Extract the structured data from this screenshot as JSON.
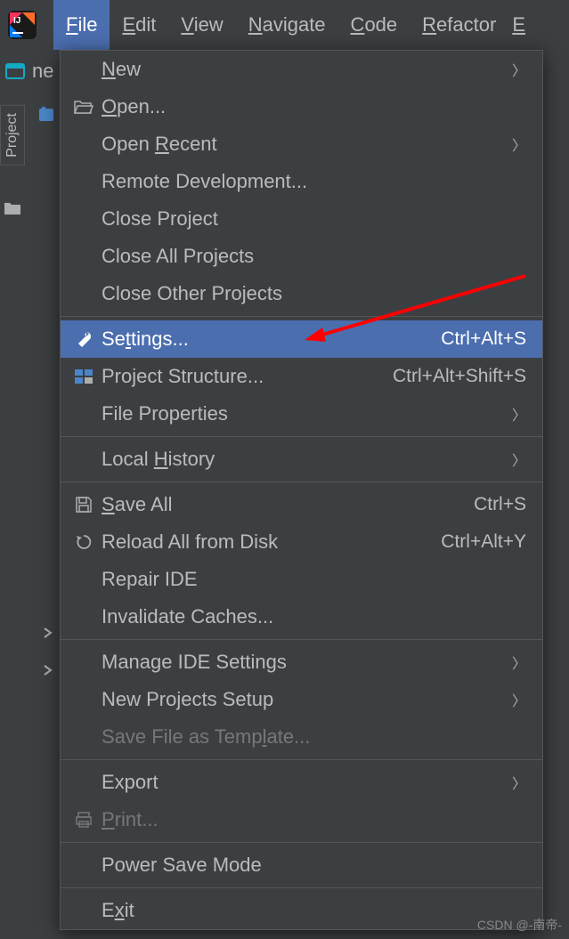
{
  "menubar": {
    "items": [
      {
        "label": "File",
        "mnemonic": "F"
      },
      {
        "label": "Edit",
        "mnemonic": "E"
      },
      {
        "label": "View",
        "mnemonic": "V"
      },
      {
        "label": "Navigate",
        "mnemonic": "N"
      },
      {
        "label": "Code",
        "mnemonic": "C"
      },
      {
        "label": "Refactor",
        "mnemonic": "R"
      }
    ],
    "trailing": "E"
  },
  "side": {
    "project_tab": "Project",
    "visible_text": "ne"
  },
  "menu": {
    "new": "New",
    "open": "Open...",
    "open_recent": "Open Recent",
    "remote_dev": "Remote Development...",
    "close_project": "Close Project",
    "close_all": "Close All Projects",
    "close_other": "Close Other Projects",
    "settings": "Settings...",
    "settings_shortcut": "Ctrl+Alt+S",
    "project_structure": "Project Structure...",
    "project_structure_shortcut": "Ctrl+Alt+Shift+S",
    "file_properties": "File Properties",
    "local_history": "Local History",
    "save_all": "Save All",
    "save_all_shortcut": "Ctrl+S",
    "reload": "Reload All from Disk",
    "reload_shortcut": "Ctrl+Alt+Y",
    "repair": "Repair IDE",
    "invalidate": "Invalidate Caches...",
    "manage_ide": "Manage IDE Settings",
    "new_projects_setup": "New Projects Setup",
    "save_template": "Save File as Template...",
    "export": "Export",
    "print": "Print...",
    "power_save": "Power Save Mode",
    "exit": "Exit"
  },
  "watermark": "CSDN @-南帝-"
}
